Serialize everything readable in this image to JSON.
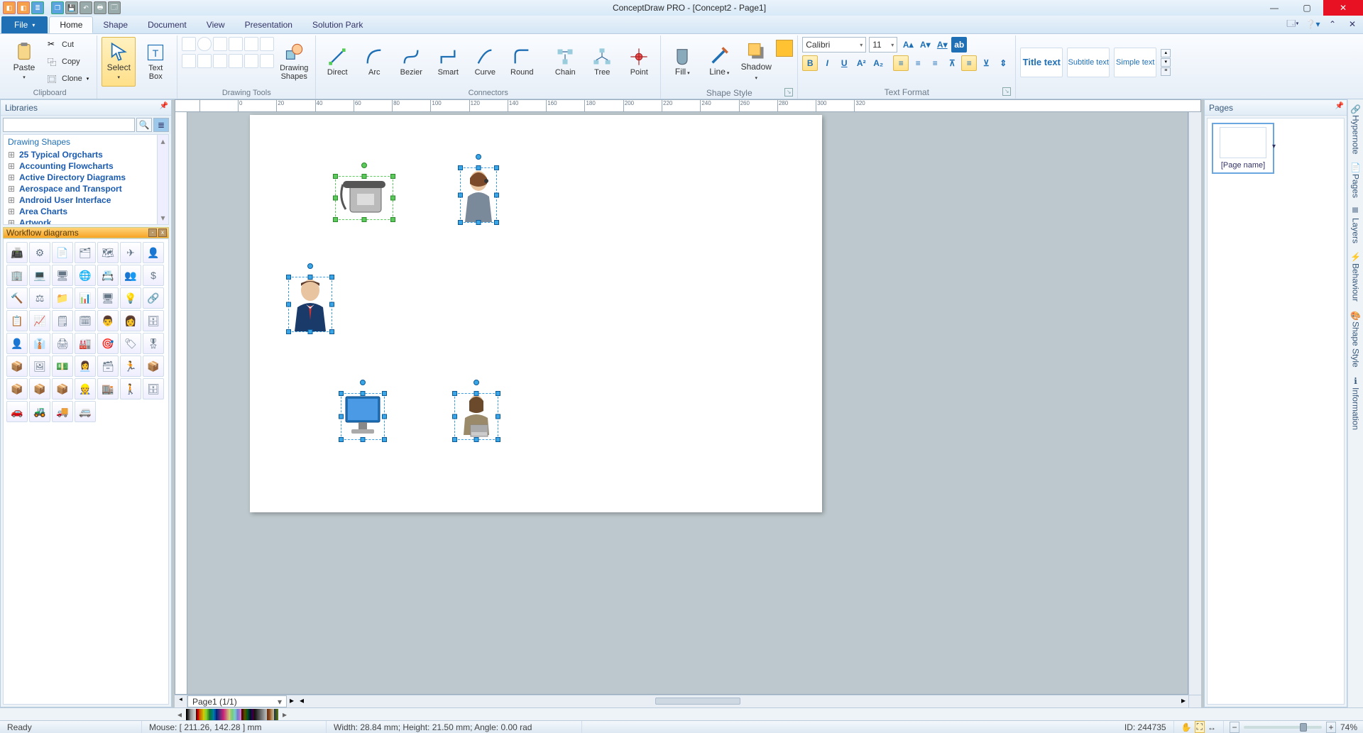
{
  "titlebar": {
    "title": "ConceptDraw PRO - [Concept2 - Page1]"
  },
  "tabs": {
    "file": "File",
    "items": [
      "Home",
      "Shape",
      "Document",
      "View",
      "Presentation",
      "Solution Park"
    ],
    "active": "Home"
  },
  "ribbon": {
    "clipboard": {
      "paste": "Paste",
      "cut": "Cut",
      "copy": "Copy",
      "clone": "Clone",
      "group": "Clipboard"
    },
    "select_textbox": {
      "select": "Select",
      "textbox": "Text\nBox"
    },
    "drawing_tools": {
      "shapes": "Drawing\nShapes",
      "group": "Drawing Tools"
    },
    "connectors": {
      "direct": "Direct",
      "arc": "Arc",
      "bezier": "Bezier",
      "smart": "Smart",
      "curve": "Curve",
      "round": "Round",
      "chain": "Chain",
      "tree": "Tree",
      "point": "Point",
      "group": "Connectors"
    },
    "shape_style": {
      "fill": "Fill",
      "line": "Line",
      "shadow": "Shadow",
      "swatch": "",
      "group": "Shape Style"
    },
    "text_format": {
      "font": "Calibri",
      "size": "11",
      "group": "Text Format"
    },
    "styles": {
      "title": "Title text",
      "subtitle": "Subtitle text",
      "simple": "Simple text"
    }
  },
  "libraries": {
    "header": "Libraries",
    "search_placeholder": "",
    "tree_header": "Drawing Shapes",
    "nodes": [
      "25 Typical Orgcharts",
      "Accounting Flowcharts",
      "Active Directory Diagrams",
      "Aerospace and Transport",
      "Android User Interface",
      "Area Charts",
      "Artwork"
    ],
    "stencil_title": "Workflow diagrams"
  },
  "pages_panel": {
    "header": "Pages",
    "thumb_caption": "[Page name]"
  },
  "side_tabs": [
    "Hypernote",
    "Pages",
    "Layers",
    "Behaviour",
    "Shape Style",
    "Information"
  ],
  "page_tab": "Page1 (1/1)",
  "status": {
    "ready": "Ready",
    "mouse": "Mouse: [ 211.26, 142.28 ] mm",
    "dims": "Width: 28.84 mm;  Height: 21.50 mm;  Angle: 0.00 rad",
    "id": "ID: 244735",
    "zoom": "74%"
  },
  "colors": [
    "#000000",
    "#3f3f3f",
    "#7f7f7f",
    "#bfbfbf",
    "#d9d9d9",
    "#f2f2f2",
    "#ffffff",
    "#7f0000",
    "#ff0000",
    "#ff6600",
    "#ff9900",
    "#ffcc00",
    "#ffff00",
    "#ccff33",
    "#99ff33",
    "#66cc33",
    "#339933",
    "#009966",
    "#009999",
    "#0099cc",
    "#0066cc",
    "#003399",
    "#333399",
    "#663399",
    "#993399",
    "#cc3399",
    "#ff3399",
    "#ff6699",
    "#ff9999",
    "#ffcc99",
    "#ffff99",
    "#ccff99",
    "#99ff99",
    "#99ffcc",
    "#99ffff",
    "#99ccff",
    "#9999ff",
    "#cc99ff",
    "#ff99ff",
    "#660000",
    "#663300",
    "#666600",
    "#336600",
    "#006633",
    "#003333",
    "#001a33",
    "#330066",
    "#4d0033",
    "#1a1a1a",
    "#333333",
    "#4d4d4d",
    "#666666",
    "#808080",
    "#999999",
    "#b3b3b3",
    "#cccccc",
    "#e6e6e6",
    "#8b4513",
    "#a0522d",
    "#cd853f",
    "#deb887",
    "#f5deb3",
    "#2f4f4f",
    "#556b2f",
    "#6b8e23"
  ]
}
